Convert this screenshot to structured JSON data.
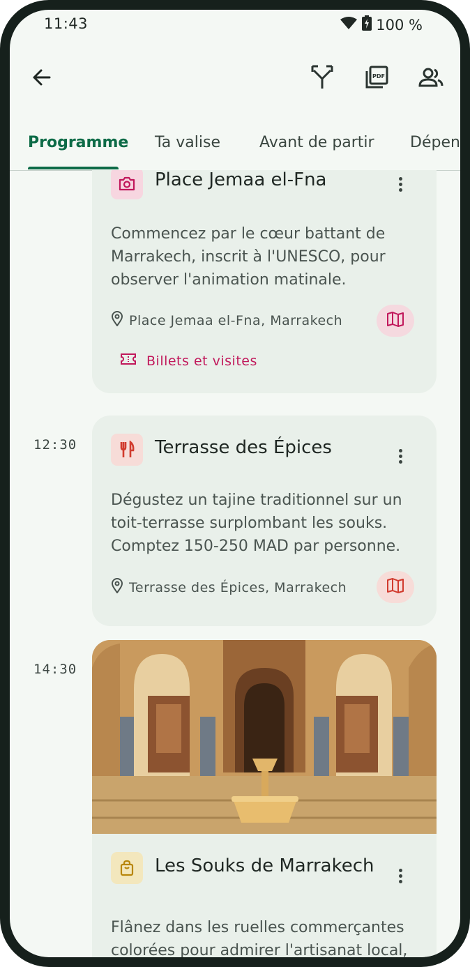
{
  "status": {
    "time": "11:43",
    "battery": "100 %"
  },
  "appbar": {
    "back_icon": "arrow-back-icon",
    "actions": [
      "fork-icon",
      "pdf-icon",
      "group-icon"
    ]
  },
  "tabs": [
    {
      "label": "Programme",
      "active": true
    },
    {
      "label": "Ta valise",
      "active": false
    },
    {
      "label": "Avant de partir",
      "active": false
    },
    {
      "label": "Dépenses",
      "active": false
    }
  ],
  "items": [
    {
      "time": "",
      "category_icon": "camera-icon",
      "title": "Place Jemaa el-Fna",
      "description": "Commencez par le cœur battant de Marrakech, inscrit à l'UNESCO, pour observer l'animation matinale.",
      "location": "Place Jemaa el-Fna, Marrakech",
      "tickets_label": "Billets et visites"
    },
    {
      "time": "12:30",
      "category_icon": "restaurant-icon",
      "title": "Terrasse des Épices",
      "description": "Dégustez un tajine traditionnel sur un toit-terrasse surplombant les souks. Comptez 150-250 MAD par personne.",
      "location": "Terrasse des Épices, Marrakech"
    },
    {
      "time": "14:30",
      "category_icon": "shopping-bag-icon",
      "title": "Les Souks de Marrakech",
      "description": "Flânez dans les ruelles commerçantes colorées pour admirer l'artisanat local,"
    }
  ],
  "colors": {
    "accent": "#0d6b47",
    "pink": "#c1185b",
    "card_bg": "#e9f0ea",
    "screen_bg": "#f4f8f4"
  }
}
